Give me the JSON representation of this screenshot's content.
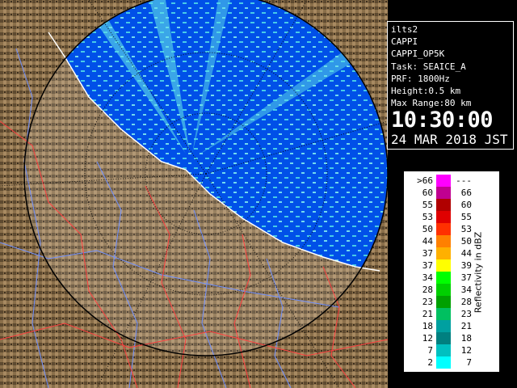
{
  "radar": {
    "site": "ilts2",
    "product": "CAPPI",
    "product_code": "CAPPI_OP5K",
    "task": "Task: SEAICE_A",
    "prf": "PRF: 1800Hz",
    "height": "Height:0.5 km",
    "max_range": "Max Range:80 km",
    "time": "10:30:00",
    "date": "24 MAR 2018 JST"
  },
  "legend": {
    "title": "Reflectivity in dBZ",
    "rows": [
      {
        "low": ">66",
        "high": "---",
        "color": "#ff00ff"
      },
      {
        "low": "60",
        "high": "66",
        "color": "#c00090"
      },
      {
        "low": "55",
        "high": "60",
        "color": "#b00000"
      },
      {
        "low": "53",
        "high": "55",
        "color": "#e00000"
      },
      {
        "low": "50",
        "high": "53",
        "color": "#ff3000"
      },
      {
        "low": "44",
        "high": "50",
        "color": "#ff8000"
      },
      {
        "low": "37",
        "high": "44",
        "color": "#ffb000"
      },
      {
        "low": "37",
        "high": "39",
        "color": "#ffff00"
      },
      {
        "low": "34",
        "high": "37",
        "color": "#00ff00"
      },
      {
        "low": "28",
        "high": "34",
        "color": "#00d000"
      },
      {
        "low": "23",
        "high": "28",
        "color": "#00a000"
      },
      {
        "low": "21",
        "high": "23",
        "color": "#00c060"
      },
      {
        "low": "18",
        "high": "21",
        "color": "#00a0a0"
      },
      {
        "low": "12",
        "high": "18",
        "color": "#008080"
      },
      {
        "low": "7",
        "high": "12",
        "color": "#00c0c0"
      },
      {
        "low": "2",
        "high": "7",
        "color": "#00ffff"
      }
    ]
  },
  "colors": {
    "sea": "#0050e8",
    "land": "#8a6f4a",
    "coast": "#ffffff",
    "rivers": "#7090ff",
    "roads": "#ff4040",
    "background": "#000000"
  }
}
